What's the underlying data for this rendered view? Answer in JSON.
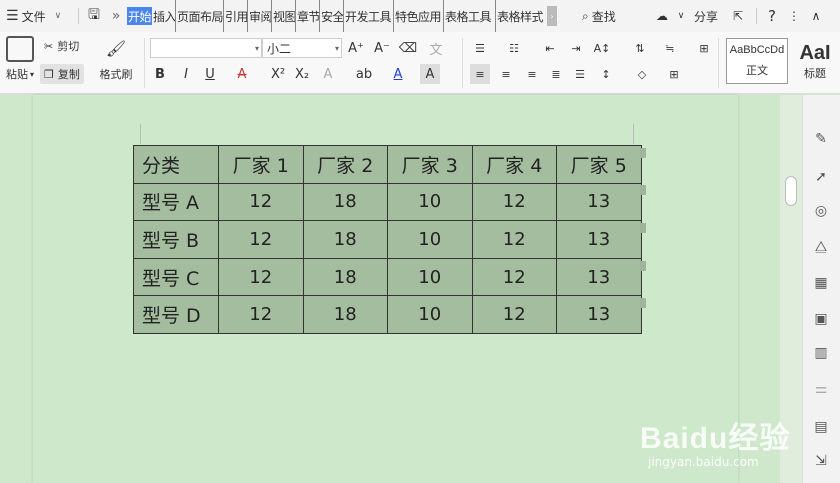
{
  "menubar": {
    "file_label": "文件",
    "tabs": [
      "开始",
      "插入",
      "页面布局",
      "引用",
      "审阅",
      "视图",
      "章节",
      "安全",
      "开发工具",
      "特色应用",
      "表格工具",
      "表格样式"
    ],
    "search_label": "查找",
    "share_label": "分享"
  },
  "ribbon": {
    "paste_label": "粘贴",
    "cut_label": "剪切",
    "copy_label": "复制",
    "format_painter_label": "格式刷",
    "font_name": "",
    "font_size": "小二",
    "style_normal_sample": "AaBbCcDd",
    "style_normal_label": "正文",
    "style_heading_sample": "AaI",
    "style_heading_label": "标题"
  },
  "table": {
    "header": [
      "分类",
      "厂家 1",
      "厂家 2",
      "厂家 3",
      "厂家 4",
      "厂家 5"
    ],
    "rows": [
      [
        "型号 A",
        "12",
        "18",
        "10",
        "12",
        "13"
      ],
      [
        "型号 B",
        "12",
        "18",
        "10",
        "12",
        "13"
      ],
      [
        "型号 C",
        "12",
        "18",
        "10",
        "12",
        "13"
      ],
      [
        "型号 D",
        "12",
        "18",
        "10",
        "12",
        "13"
      ]
    ]
  },
  "watermark": {
    "brand": "Baidu经验",
    "url": "jingyan.baidu.com"
  },
  "colors": {
    "active_tab": "#4a86e8",
    "table_fill": "#a4bd9f",
    "doc_background": "#cde8cb"
  }
}
